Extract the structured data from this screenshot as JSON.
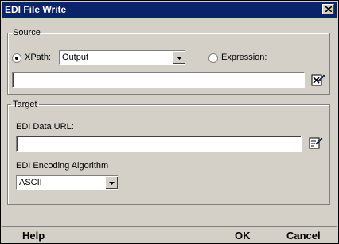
{
  "window": {
    "title": "EDI File Write"
  },
  "source": {
    "legend": "Source",
    "xpath_label": "XPath:",
    "xpath_value": "Output",
    "expression_label": "Expression:",
    "xpath_text": ""
  },
  "target": {
    "legend": "Target",
    "url_label": "EDI Data URL:",
    "url_value": "",
    "encoding_label": "EDI Encoding Algorithm",
    "encoding_value": "ASCII"
  },
  "buttons": {
    "help": "Help",
    "ok": "OK",
    "cancel": "Cancel"
  },
  "colors": {
    "titlebar": "#0a246a",
    "face": "#d4d0c8"
  },
  "icons": [
    "close-icon",
    "xpath-editor-icon",
    "edit-url-icon",
    "dropdown-arrow-icon"
  ]
}
